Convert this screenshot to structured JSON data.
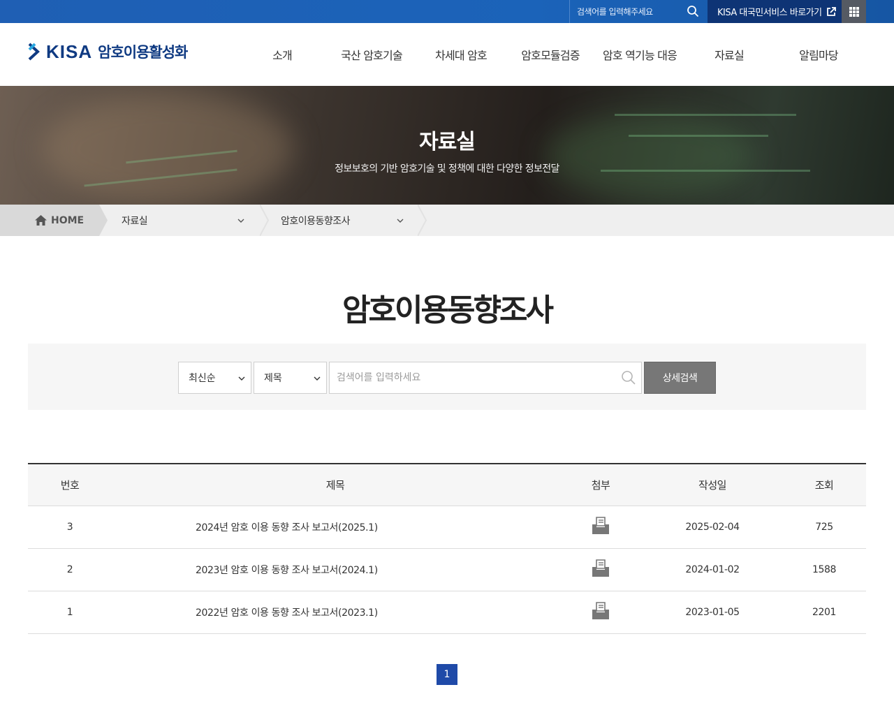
{
  "topbar": {
    "search_placeholder": "검색어를 입력해주세요",
    "kisa_link": "KISA 대국민서비스 바로가기"
  },
  "header": {
    "logo_word": "KISA",
    "logo_sub": "암호이용활성화",
    "nav": [
      "소개",
      "국산 암호기술",
      "차세대 암호",
      "암호모듈검증",
      "암호 역기능 대응",
      "자료실",
      "알림마당"
    ]
  },
  "visual": {
    "title": "자료실",
    "subtitle": "정보보호의 기반 암호기술 및 정책에 대한 다양한 정보전달"
  },
  "breadcrumb": {
    "home": "HOME",
    "level1": "자료실",
    "level2": "암호이용동향조사"
  },
  "page": {
    "title": "암호이용동향조사"
  },
  "search": {
    "sort_selected": "최신순",
    "field_selected": "제목",
    "placeholder": "검색어를 입력하세요",
    "detail_button": "상세검색"
  },
  "table": {
    "headers": {
      "no": "번호",
      "title": "제목",
      "file": "첨부",
      "date": "작성일",
      "views": "조회"
    },
    "rows": [
      {
        "no": "3",
        "title": "2024년 암호 이용 동향 조사 보고서(2025.1)",
        "date": "2025-02-04",
        "views": "725"
      },
      {
        "no": "2",
        "title": "2023년 암호 이용 동향 조사 보고서(2024.1)",
        "date": "2024-01-02",
        "views": "1588"
      },
      {
        "no": "1",
        "title": "2022년 암호 이용 동향 조사 보고서(2023.1)",
        "date": "2023-01-05",
        "views": "2201"
      }
    ]
  },
  "pagination": {
    "current": "1"
  },
  "colors": {
    "brand": "#0f3a82",
    "topbar": "#1f5fb4",
    "pager": "#1f4aa8",
    "button": "#777777"
  }
}
